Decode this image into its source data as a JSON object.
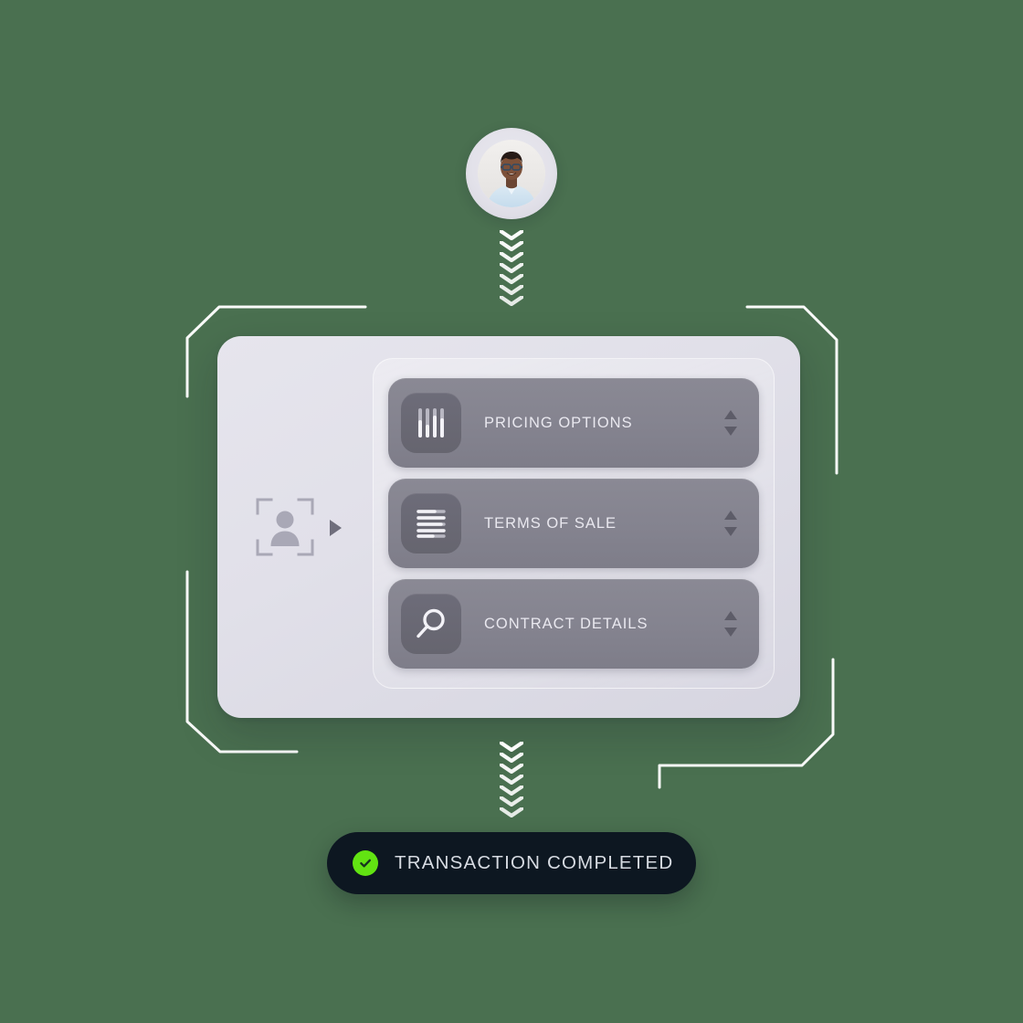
{
  "theme": {
    "background": "#4a7050",
    "card_bg": "#e3e2ea",
    "row_bg": "#84838f",
    "row_icon_bg": "#6a6974",
    "row_text": "#e9e8ef",
    "status_pill_bg": "#0d1721",
    "status_accent": "#62e312",
    "bracket_color": "#ffffff",
    "chevron_color": "#ffffff"
  },
  "avatar": {
    "icon": "user-photo-avatar",
    "alt": "Customer portrait"
  },
  "flow": {
    "chevrons_top": {
      "icon": "chevron-down-icon",
      "count": 7,
      "direction": "down"
    },
    "chevrons_bottom": {
      "icon": "chevron-down-icon",
      "count": 7,
      "direction": "down"
    }
  },
  "frame": {
    "brackets": [
      {
        "name": "bracket-top-left",
        "position": "top-left"
      },
      {
        "name": "bracket-top-right",
        "position": "top-right"
      },
      {
        "name": "bracket-bottom-left",
        "position": "bottom-left"
      },
      {
        "name": "bracket-bottom-right",
        "position": "bottom-right"
      }
    ]
  },
  "card": {
    "scan": {
      "face_scan_icon": "face-scan-icon",
      "play_icon": "play-triangle-icon"
    },
    "rows": [
      {
        "label": "PRICING OPTIONS",
        "icon": "equalizer-sliders-icon",
        "stepper_icon": "up-down-stepper-icon"
      },
      {
        "label": "TERMS OF SALE",
        "icon": "document-lines-icon",
        "stepper_icon": "up-down-stepper-icon"
      },
      {
        "label": "CONTRACT DETAILS",
        "icon": "magnifier-search-icon",
        "stepper_icon": "up-down-stepper-icon"
      }
    ]
  },
  "status": {
    "label": "TRANSACTION COMPLETED",
    "icon": "check-circle-icon",
    "state": "completed"
  }
}
